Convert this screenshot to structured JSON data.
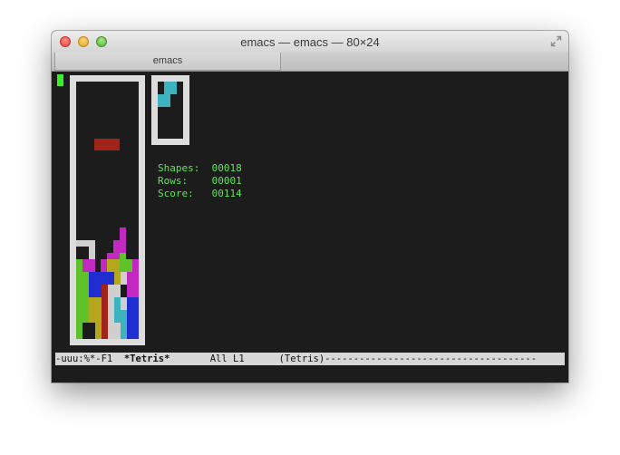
{
  "window": {
    "title": "emacs — emacs — 80×24",
    "tab_label": "emacs"
  },
  "game": {
    "name": "Tetris",
    "shapes_label": "Shapes:",
    "shapes_value": "00018",
    "rows_label": "Rows:",
    "rows_value": "00001",
    "score_label": "Score:",
    "score_value": "00114"
  },
  "modeline": {
    "status": "-uuu:%*-F1",
    "buffer": "*Tetris*",
    "position": "All L1",
    "mode": "(Tetris)",
    "fill": "-------------------------------------"
  },
  "colors": {
    "border": "#dcdcdc",
    "text_green": "#5ee45a",
    "red": "#a1231a",
    "magenta": "#c229c0",
    "blue": "#1f2dd1",
    "green": "#5fc22b",
    "olive": "#b4a71d",
    "cyan": "#3eb3c0",
    "grey": "#cfcfcf"
  },
  "icons": {
    "close": "close-button",
    "minimize": "minimize-button",
    "zoom": "zoom-button",
    "fullscreen": "fullscreen-arrows-icon"
  }
}
